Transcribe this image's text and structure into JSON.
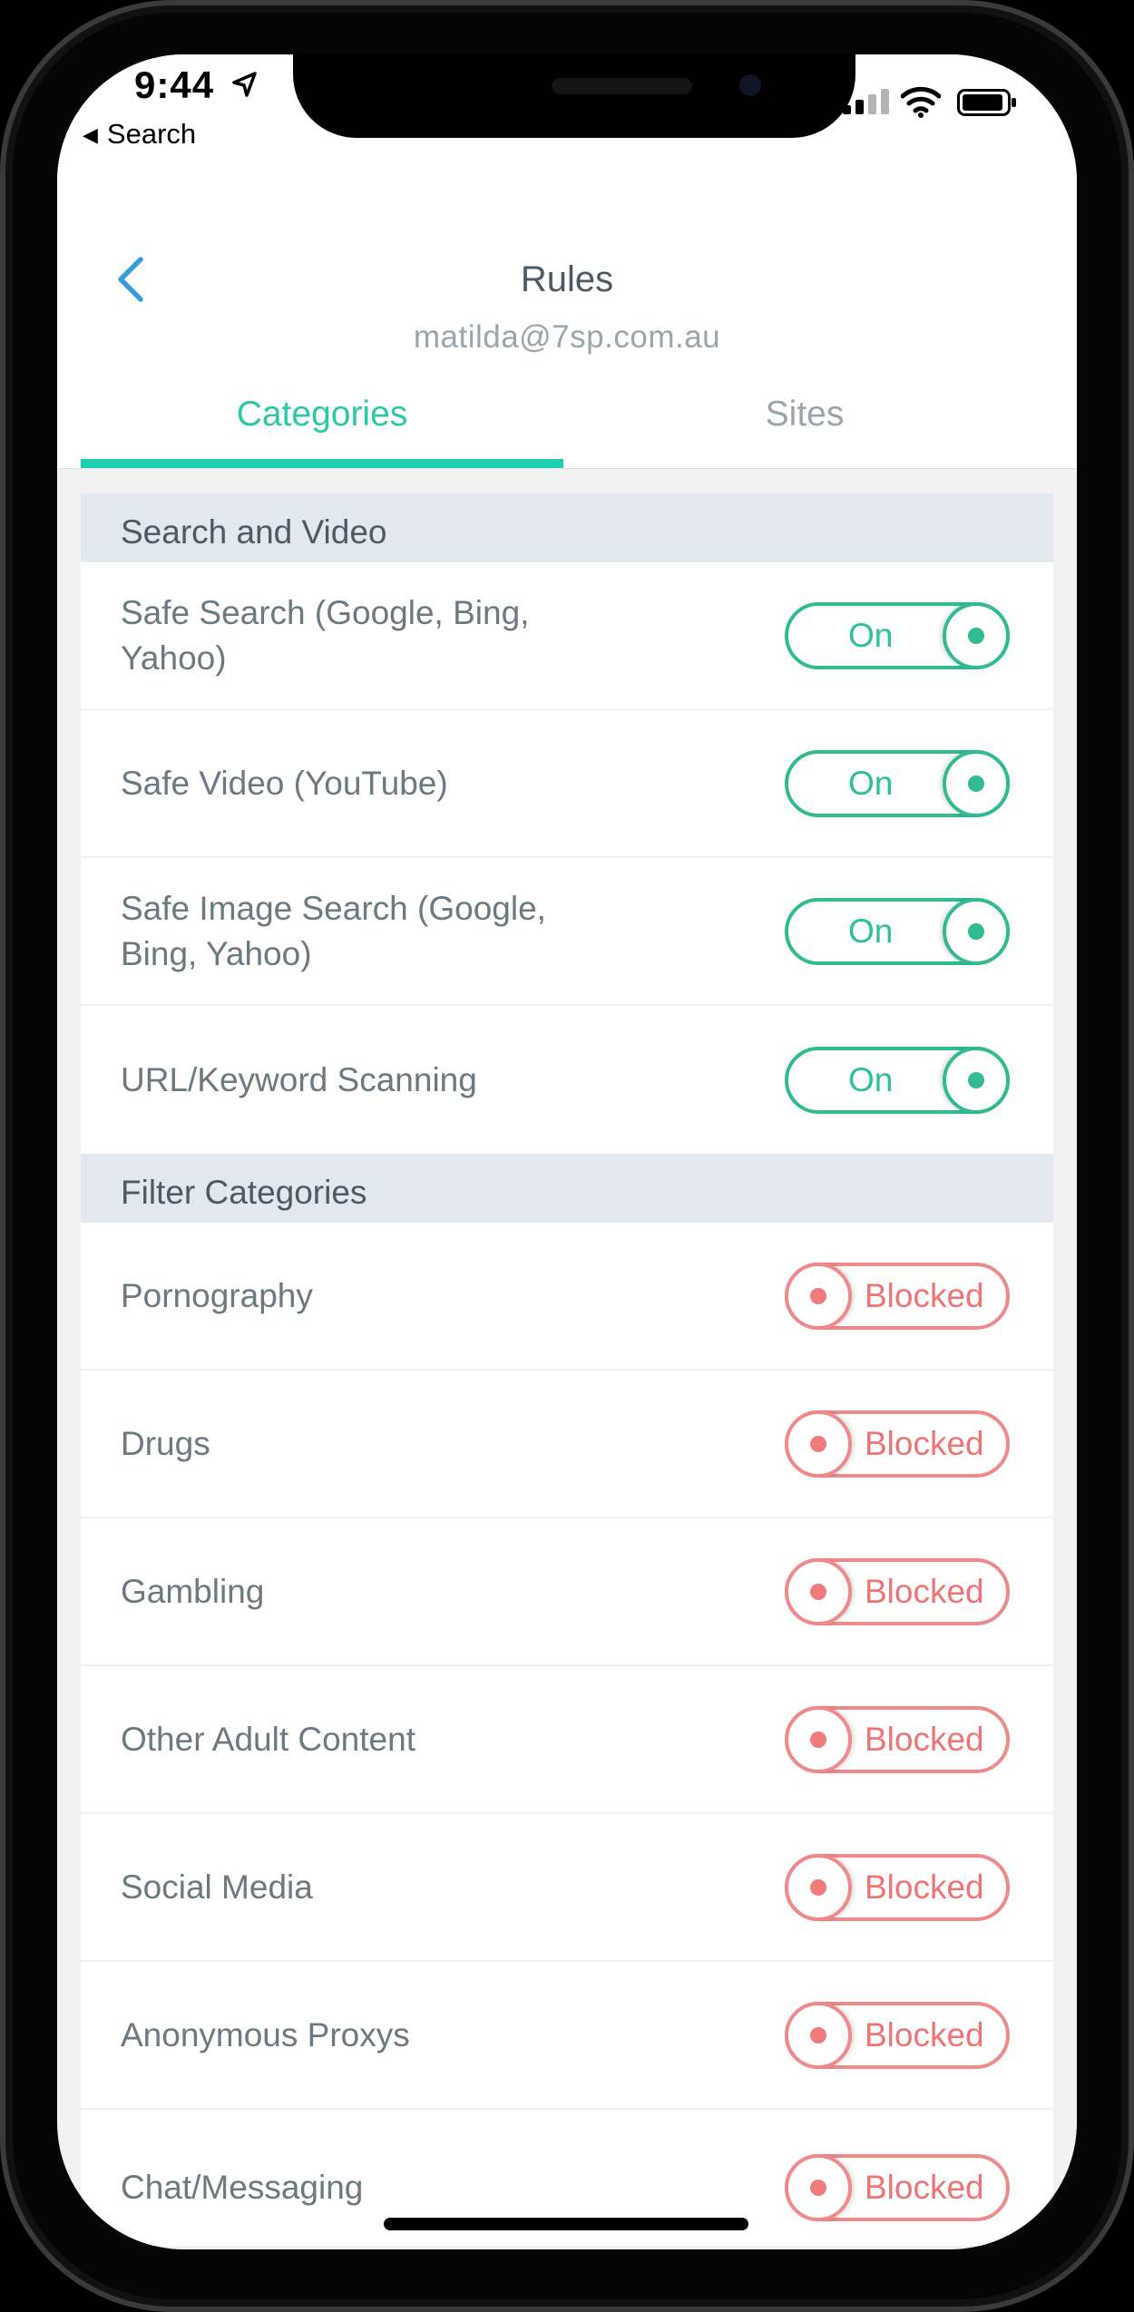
{
  "status_bar": {
    "time": "9:44",
    "back_app": "Search",
    "icons": [
      "location-arrow-icon",
      "cellular-signal-icon",
      "wifi-icon",
      "battery-icon"
    ]
  },
  "header": {
    "title": "Rules",
    "subtitle": "matilda@7sp.com.au",
    "tabs": [
      {
        "label": "Categories",
        "active": true
      },
      {
        "label": "Sites",
        "active": false
      }
    ]
  },
  "sections": [
    {
      "title": "Search and Video",
      "items": [
        {
          "label": "Safe Search (Google, Bing, Yahoo)",
          "state": "On"
        },
        {
          "label": "Safe Video (YouTube)",
          "state": "On"
        },
        {
          "label": "Safe Image Search (Google, Bing, Yahoo)",
          "state": "On"
        },
        {
          "label": "URL/Keyword Scanning",
          "state": "On"
        }
      ]
    },
    {
      "title": "Filter Categories",
      "items": [
        {
          "label": "Pornography",
          "state": "Blocked"
        },
        {
          "label": "Drugs",
          "state": "Blocked"
        },
        {
          "label": "Gambling",
          "state": "Blocked"
        },
        {
          "label": "Other Adult Content",
          "state": "Blocked"
        },
        {
          "label": "Social Media",
          "state": "Blocked"
        },
        {
          "label": "Anonymous Proxys",
          "state": "Blocked"
        },
        {
          "label": "Chat/Messaging",
          "state": "Blocked"
        }
      ]
    }
  ],
  "colors": {
    "accent": "#1dd1b0",
    "on": "#32bb92",
    "blocked": "#ef7b7b",
    "back_chevron": "#3a9bd9"
  }
}
